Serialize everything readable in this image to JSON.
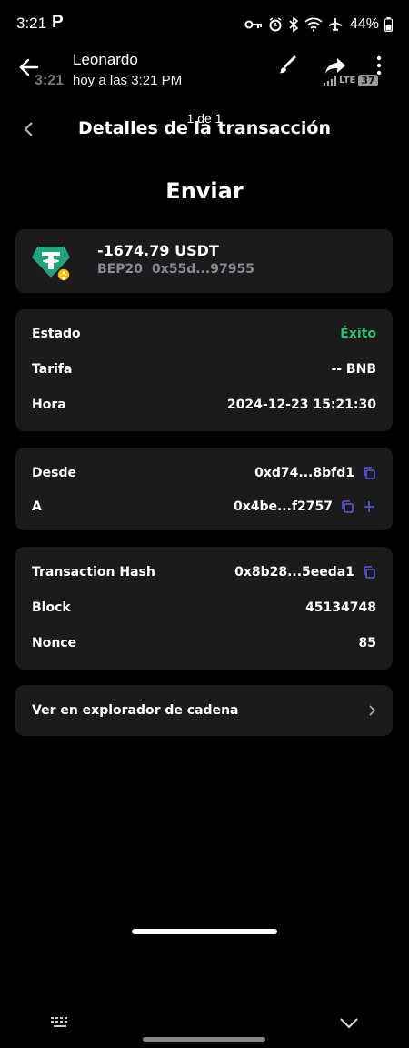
{
  "status_bar": {
    "time": "3:21",
    "app_glyph": "P",
    "battery": "44%",
    "icons": [
      "key-icon",
      "alarm-icon",
      "bluetooth-icon",
      "wifi-icon",
      "airplane-icon",
      "battery-icon"
    ]
  },
  "viewer": {
    "sender": "Leonardo",
    "timestamp": "hoy a las 3:21 PM",
    "ghost_time": "3:21",
    "network": "LTE",
    "network_badge": "37",
    "actions": [
      "brush-icon",
      "share-icon",
      "more-icon"
    ]
  },
  "nav": {
    "page_indicator": "1 de 1",
    "title": "Detalles de la transacción"
  },
  "hero": {
    "title": "Enviar"
  },
  "asset": {
    "amount": "-1674.79 USDT",
    "network": "BEP20",
    "contract": "0x55d...97955",
    "colors": {
      "token": "#26a17b",
      "badge": "#f0b90b"
    }
  },
  "status_card": {
    "rows": [
      {
        "label": "Estado",
        "value": "Éxito"
      },
      {
        "label": "Tarifa",
        "value": "-- BNB"
      },
      {
        "label": "Hora",
        "value": "2024-12-23 15:21:30"
      }
    ]
  },
  "addresses": {
    "from_label": "Desde",
    "from_value": "0xd74...8bfd1",
    "to_label": "A",
    "to_value": "0x4be...f2757"
  },
  "hash_card": {
    "rows": [
      {
        "label": "Transaction Hash",
        "value": "0x8b28...5eeda1"
      },
      {
        "label": "Block",
        "value": "45134748"
      },
      {
        "label": "Nonce",
        "value": "85"
      }
    ]
  },
  "explorer": {
    "label": "Ver en explorador de cadena"
  },
  "colors": {
    "success": "#2fbf71",
    "accent": "#5b5bd6",
    "card": "#1b1b1d"
  }
}
